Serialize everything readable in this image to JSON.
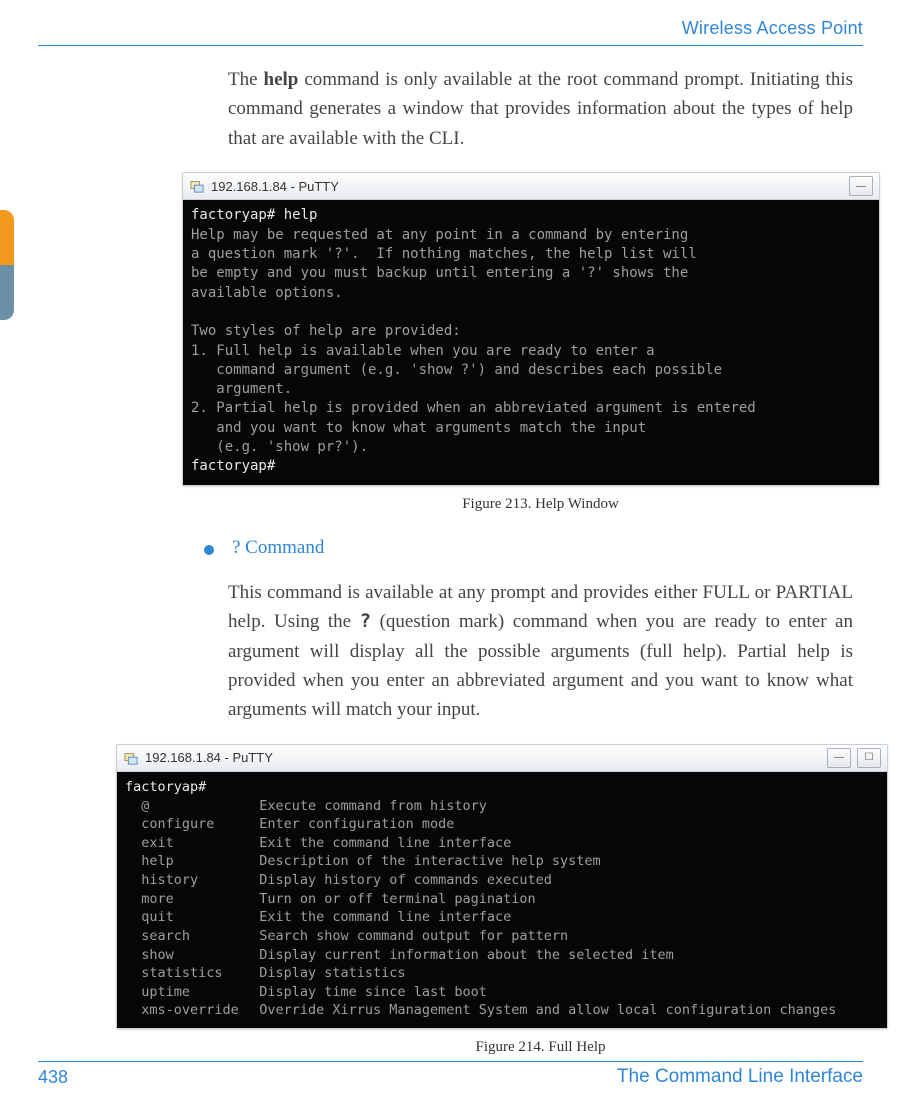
{
  "header": {
    "title": "Wireless Access Point"
  },
  "intro": {
    "pre": "The ",
    "bold": "help",
    "post": " command is only available at the root command prompt. Initiating this command generates a window that provides information about the types of help that are available with the CLI."
  },
  "term1": {
    "title": "192.168.1.84 - PuTTY",
    "lines": {
      "l0": "factoryap# help",
      "l1": "Help may be requested at any point in a command by entering",
      "l2": "a question mark '?'.  If nothing matches, the help list will",
      "l3": "be empty and you must backup until entering a '?' shows the",
      "l4": "available options.",
      "l5": "",
      "l6": "Two styles of help are provided:",
      "l7": "1. Full help is available when you are ready to enter a",
      "l8": "   command argument (e.g. 'show ?') and describes each possible",
      "l9": "   argument.",
      "l10": "2. Partial help is provided when an abbreviated argument is entered",
      "l11": "   and you want to know what arguments match the input",
      "l12": "   (e.g. 'show pr?').",
      "l13": "factoryap#"
    }
  },
  "fig1": "Figure 213. Help Window",
  "bullet1": {
    "title": "? Command"
  },
  "para2": {
    "p1": "This command is available at any prompt and provides either FULL or PARTIAL help. Using the ",
    "code": "?",
    "p2": " (question mark) command when you are ready to enter an argument will display all the possible arguments (full help). Partial help is provided when you enter an abbreviated argument and you want to know what arguments will match your input."
  },
  "term2": {
    "title": "192.168.1.84 - PuTTY",
    "prompt": "factoryap#",
    "rows": [
      {
        "cmd": "@",
        "desc": "Execute command from history"
      },
      {
        "cmd": "configure",
        "desc": "Enter configuration mode"
      },
      {
        "cmd": "exit",
        "desc": "Exit the command line interface"
      },
      {
        "cmd": "help",
        "desc": "Description of the interactive help system"
      },
      {
        "cmd": "history",
        "desc": "Display history of commands executed"
      },
      {
        "cmd": "more",
        "desc": "Turn on or off terminal pagination"
      },
      {
        "cmd": "quit",
        "desc": "Exit the command line interface"
      },
      {
        "cmd": "search",
        "desc": "Search show command output for pattern"
      },
      {
        "cmd": "show",
        "desc": "Display current information about the selected item"
      },
      {
        "cmd": "statistics",
        "desc": "Display statistics"
      },
      {
        "cmd": "uptime",
        "desc": "Display time since last boot"
      },
      {
        "cmd": "xms-override",
        "desc": "Override Xirrus Management System and allow local configuration changes"
      }
    ]
  },
  "fig2": "Figure 214. Full Help",
  "footer": {
    "page": "438",
    "section": "The Command Line Interface"
  }
}
